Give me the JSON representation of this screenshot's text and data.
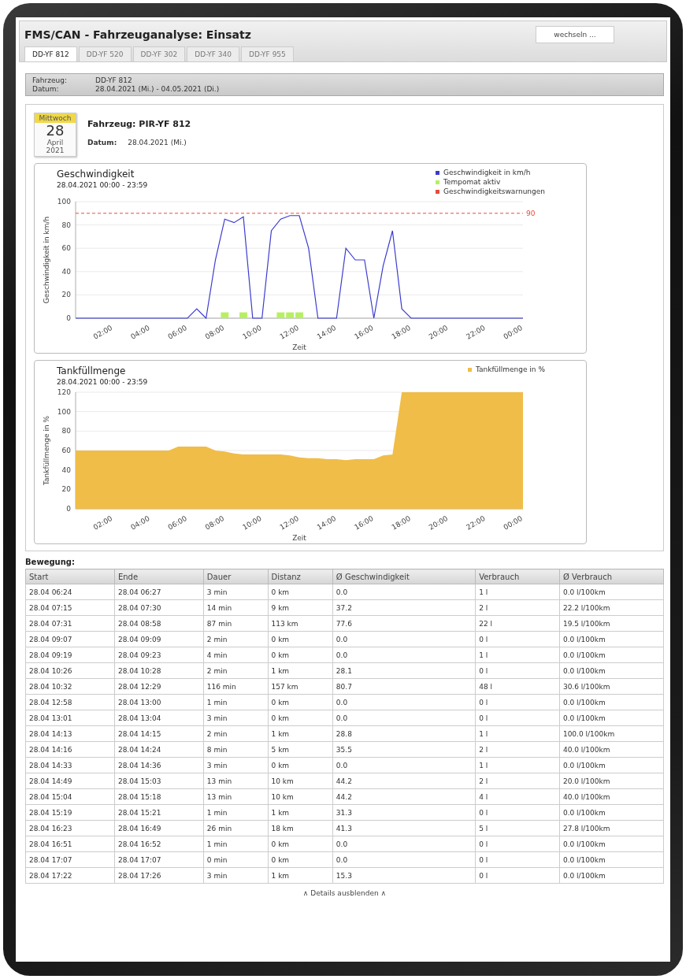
{
  "header": {
    "title": "FMS/CAN - Fahrzeuganalyse: Einsatz",
    "button": "wechseln ..."
  },
  "tabs": [
    {
      "label": "DD-YF 812",
      "selected": true
    },
    {
      "label": "DD-YF 520",
      "selected": false
    },
    {
      "label": "DD-YF 302",
      "selected": false
    },
    {
      "label": "DD-YF 340",
      "selected": false
    },
    {
      "label": "DD-YF 955",
      "selected": false
    }
  ],
  "info": [
    {
      "label": "Fahrzeug:",
      "value": "DD-YF 812"
    },
    {
      "label": "Datum:",
      "value": "28.04.2021 (Mi.) - 04.05.2021 (Di.)"
    }
  ],
  "day": {
    "calendar": {
      "weekday": "Mittwoch",
      "day": "28",
      "month": "April",
      "year": "2021"
    },
    "vehicle": "Fahrzeug: PIR-YF 812",
    "date_label": "Datum:",
    "date": "28.04.2021 (Mi.)"
  },
  "charts": [
    {
      "subtitle": "28.04.2021 00:00 - 23:59",
      "chart_data": {
        "type": "line",
        "title": "Geschwindigkeit",
        "xlabel": "Zeit",
        "ylabel": "Geschwindigkeit in km/h",
        "x": [
          0,
          0.5,
          1,
          1.5,
          2,
          2.5,
          3,
          3.5,
          4,
          4.5,
          5,
          5.5,
          6,
          6.5,
          7,
          7.5,
          8,
          8.5,
          9,
          9.5,
          10,
          10.5,
          11,
          11.5,
          12,
          12.5,
          13,
          13.5,
          14,
          14.5,
          15,
          15.5,
          16,
          16.5,
          17,
          17.5,
          18,
          18.5,
          19,
          19.5,
          20,
          20.5,
          21,
          21.5,
          22,
          22.5,
          23,
          23.5,
          24
        ],
        "series": [
          {
            "name": "Geschwindigkeit in km/h",
            "color": "#3b3bd0",
            "values": [
              0,
              0,
              0,
              0,
              0,
              0,
              0,
              0,
              0,
              0,
              0,
              0,
              0,
              8,
              0,
              50,
              85,
              82,
              87,
              0,
              0,
              75,
              85,
              88,
              88,
              60,
              0,
              0,
              0,
              60,
              50,
              50,
              0,
              45,
              75,
              8,
              0,
              0,
              0,
              0,
              0,
              0,
              0,
              0,
              0,
              0,
              0,
              0,
              0
            ]
          },
          {
            "name": "Tempomat aktiv",
            "type": "bar",
            "color": "#b6f060",
            "values": [
              null,
              null,
              null,
              null,
              null,
              null,
              null,
              null,
              null,
              null,
              null,
              null,
              null,
              null,
              null,
              null,
              5,
              null,
              5,
              null,
              null,
              null,
              5,
              5,
              5,
              null,
              null,
              null,
              null,
              null,
              null,
              null,
              null,
              null,
              null,
              null,
              null,
              null,
              null,
              null,
              null,
              null,
              null,
              null,
              null,
              null,
              null,
              null,
              null
            ]
          },
          {
            "name": "Geschwindigkeitswarnungen",
            "line_style": "dashed",
            "color": "#e84a3a",
            "values": [
              90,
              90,
              90,
              90,
              90,
              90,
              90,
              90,
              90,
              90,
              90,
              90,
              90,
              90,
              90,
              90,
              90,
              90,
              90,
              90,
              90,
              90,
              90,
              90,
              90,
              90,
              90,
              90,
              90,
              90,
              90,
              90,
              90,
              90,
              90,
              90,
              90,
              90,
              90,
              90,
              90,
              90,
              90,
              90,
              90,
              90,
              90,
              90,
              90
            ]
          }
        ],
        "xlim": [
          0,
          24
        ],
        "ylim": [
          0,
          100
        ],
        "grid": true,
        "legend": true,
        "xticks": [
          {
            "value": 2,
            "label": "02:00"
          },
          {
            "value": 4,
            "label": "04:00"
          },
          {
            "value": 6,
            "label": "06:00"
          },
          {
            "value": 8,
            "label": "08:00"
          },
          {
            "value": 10,
            "label": "10:00"
          },
          {
            "value": 12,
            "label": "12:00"
          },
          {
            "value": 14,
            "label": "14:00"
          },
          {
            "value": 16,
            "label": "16:00"
          },
          {
            "value": 18,
            "label": "18:00"
          },
          {
            "value": 20,
            "label": "20:00"
          },
          {
            "value": 22,
            "label": "22:00"
          },
          {
            "value": 24,
            "label": "00:00"
          }
        ],
        "yticks": [
          0,
          20,
          40,
          60,
          80,
          100
        ],
        "annotations": [
          {
            "x": 24,
            "y": 90,
            "text": "90"
          }
        ]
      }
    },
    {
      "subtitle": "28.04.2021 00:00 - 23:59",
      "chart_data": {
        "type": "area",
        "title": "Tankfüllmenge",
        "xlabel": "Zeit",
        "ylabel": "Tankfüllmenge in %",
        "x": [
          0,
          0.5,
          1,
          1.5,
          2,
          2.5,
          3,
          3.5,
          4,
          4.5,
          5,
          5.5,
          6,
          6.5,
          7,
          7.5,
          8,
          8.5,
          9,
          9.5,
          10,
          10.5,
          11,
          11.5,
          12,
          12.5,
          13,
          13.5,
          14,
          14.5,
          15,
          15.5,
          16,
          16.5,
          17,
          17.5,
          18,
          18.5,
          19,
          19.5,
          20,
          20.5,
          21,
          21.5,
          22,
          22.5,
          23,
          23.5,
          24
        ],
        "series": [
          {
            "name": "Tankfüllmenge in %",
            "color": "#f0bd48",
            "values": [
              60,
              60,
              60,
              60,
              60,
              60,
              60,
              60,
              60,
              60,
              60,
              64,
              64,
              64,
              64,
              60,
              59,
              57,
              56,
              56,
              56,
              56,
              56,
              55,
              53,
              52,
              52,
              51,
              51,
              50,
              51,
              51,
              51,
              55,
              56,
              120,
              120,
              120,
              120,
              120,
              120,
              120,
              120,
              120,
              120,
              120,
              120,
              120,
              120
            ]
          }
        ],
        "xlim": [
          0,
          24
        ],
        "ylim": [
          0,
          120
        ],
        "grid": true,
        "legend": true,
        "xticks": [
          {
            "value": 2,
            "label": "02:00"
          },
          {
            "value": 4,
            "label": "04:00"
          },
          {
            "value": 6,
            "label": "06:00"
          },
          {
            "value": 8,
            "label": "08:00"
          },
          {
            "value": 10,
            "label": "10:00"
          },
          {
            "value": 12,
            "label": "12:00"
          },
          {
            "value": 14,
            "label": "14:00"
          },
          {
            "value": 16,
            "label": "16:00"
          },
          {
            "value": 18,
            "label": "18:00"
          },
          {
            "value": 20,
            "label": "20:00"
          },
          {
            "value": 22,
            "label": "22:00"
          },
          {
            "value": 24,
            "label": "00:00"
          }
        ],
        "yticks": [
          0,
          20,
          40,
          60,
          80,
          100,
          120
        ]
      }
    }
  ],
  "movement": {
    "title": "Bewegung:",
    "columns": [
      "Start",
      "Ende",
      "Dauer",
      "Distanz",
      "Ø Geschwindigkeit",
      "Verbrauch",
      "Ø Verbrauch"
    ],
    "rows": [
      [
        "28.04 06:24",
        "28.04 06:27",
        "3 min",
        "0 km",
        "0.0",
        "1 l",
        "0.0 l/100km"
      ],
      [
        "28.04 07:15",
        "28.04 07:30",
        "14 min",
        "9 km",
        "37.2",
        "2 l",
        "22.2 l/100km"
      ],
      [
        "28.04 07:31",
        "28.04 08:58",
        "87 min",
        "113 km",
        "77.6",
        "22 l",
        "19.5 l/100km"
      ],
      [
        "28.04 09:07",
        "28.04 09:09",
        "2 min",
        "0 km",
        "0.0",
        "0 l",
        "0.0 l/100km"
      ],
      [
        "28.04 09:19",
        "28.04 09:23",
        "4 min",
        "0 km",
        "0.0",
        "1 l",
        "0.0 l/100km"
      ],
      [
        "28.04 10:26",
        "28.04 10:28",
        "2 min",
        "1 km",
        "28.1",
        "0 l",
        "0.0 l/100km"
      ],
      [
        "28.04 10:32",
        "28.04 12:29",
        "116 min",
        "157 km",
        "80.7",
        "48 l",
        "30.6 l/100km"
      ],
      [
        "28.04 12:58",
        "28.04 13:00",
        "1 min",
        "0 km",
        "0.0",
        "0 l",
        "0.0 l/100km"
      ],
      [
        "28.04 13:01",
        "28.04 13:04",
        "3 min",
        "0 km",
        "0.0",
        "0 l",
        "0.0 l/100km"
      ],
      [
        "28.04 14:13",
        "28.04 14:15",
        "2 min",
        "1 km",
        "28.8",
        "1 l",
        "100.0 l/100km"
      ],
      [
        "28.04 14:16",
        "28.04 14:24",
        "8 min",
        "5 km",
        "35.5",
        "2 l",
        "40.0 l/100km"
      ],
      [
        "28.04 14:33",
        "28.04 14:36",
        "3 min",
        "0 km",
        "0.0",
        "1 l",
        "0.0 l/100km"
      ],
      [
        "28.04 14:49",
        "28.04 15:03",
        "13 min",
        "10 km",
        "44.2",
        "2 l",
        "20.0 l/100km"
      ],
      [
        "28.04 15:04",
        "28.04 15:18",
        "13 min",
        "10 km",
        "44.2",
        "4 l",
        "40.0 l/100km"
      ],
      [
        "28.04 15:19",
        "28.04 15:21",
        "1 min",
        "1 km",
        "31.3",
        "0 l",
        "0.0 l/100km"
      ],
      [
        "28.04 16:23",
        "28.04 16:49",
        "26 min",
        "18 km",
        "41.3",
        "5 l",
        "27.8 l/100km"
      ],
      [
        "28.04 16:51",
        "28.04 16:52",
        "1 min",
        "0 km",
        "0.0",
        "0 l",
        "0.0 l/100km"
      ],
      [
        "28.04 17:07",
        "28.04 17:07",
        "0 min",
        "0 km",
        "0.0",
        "0 l",
        "0.0 l/100km"
      ],
      [
        "28.04 17:22",
        "28.04 17:26",
        "3 min",
        "1 km",
        "15.3",
        "0 l",
        "0.0 l/100km"
      ]
    ],
    "footer": "∧ Details ausblenden ∧"
  }
}
